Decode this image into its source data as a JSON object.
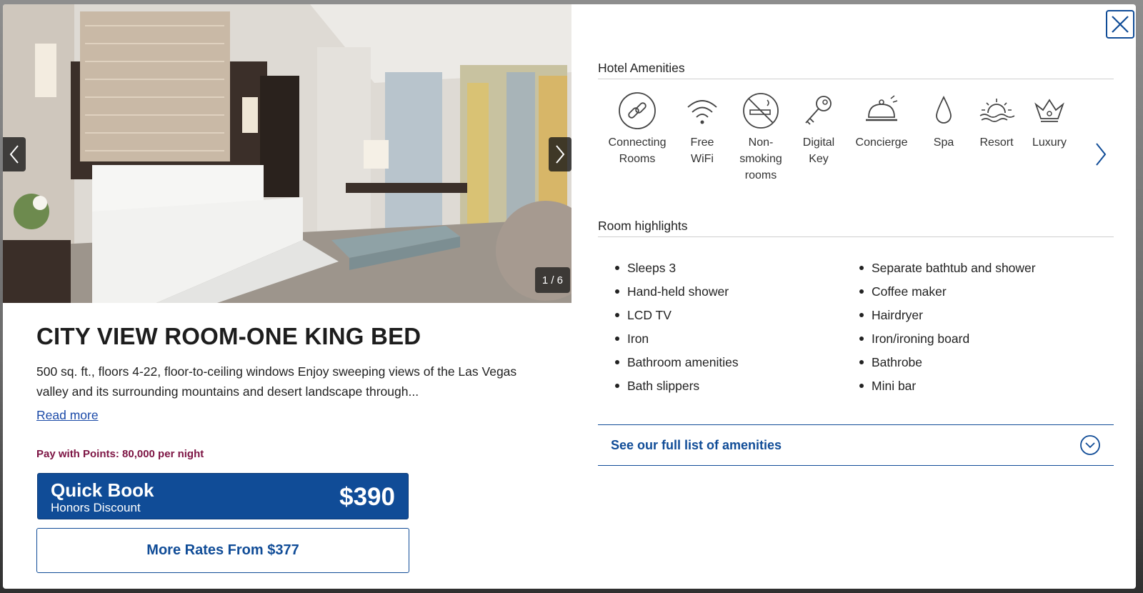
{
  "gallery": {
    "counter": "1 / 6"
  },
  "room": {
    "title": "CITY VIEW ROOM-ONE KING BED",
    "description": "500 sq. ft., floors 4-22, floor-to-ceiling windows Enjoy sweeping views of the Las Vegas valley and its surrounding mountains and desert landscape through...",
    "read_more": "Read more",
    "points": "Pay with Points: 80,000 per night"
  },
  "quick_book": {
    "title": "Quick Book",
    "subtitle": "Honors Discount",
    "price": "$390"
  },
  "more_rates": "More Rates From $377",
  "amenities": {
    "heading": "Hotel Amenities",
    "items": [
      {
        "label": "Connecting\nRooms",
        "icon": "link-icon"
      },
      {
        "label": "Free\nWiFi",
        "icon": "wifi-icon"
      },
      {
        "label": "Non-\nsmoking\nrooms",
        "icon": "no-smoking-icon"
      },
      {
        "label": "Digital\nKey",
        "icon": "key-icon"
      },
      {
        "label": "Concierge",
        "icon": "bell-icon"
      },
      {
        "label": "Spa",
        "icon": "drop-icon"
      },
      {
        "label": "Resort",
        "icon": "sunset-icon"
      },
      {
        "label": "Luxury",
        "icon": "crown-icon"
      }
    ]
  },
  "highlights": {
    "heading": "Room highlights",
    "col1": [
      "Sleeps 3",
      "Hand-held shower",
      "LCD TV",
      "Iron",
      "Bathroom amenities",
      "Bath slippers"
    ],
    "col2": [
      "Separate bathtub and shower",
      "Coffee maker",
      "Hairdryer",
      "Iron/ironing board",
      "Bathrobe",
      "Mini bar"
    ]
  },
  "full_list": "See our full list of amenities",
  "colors": {
    "brand_blue": "#104c97",
    "points_text": "#7d1544"
  }
}
